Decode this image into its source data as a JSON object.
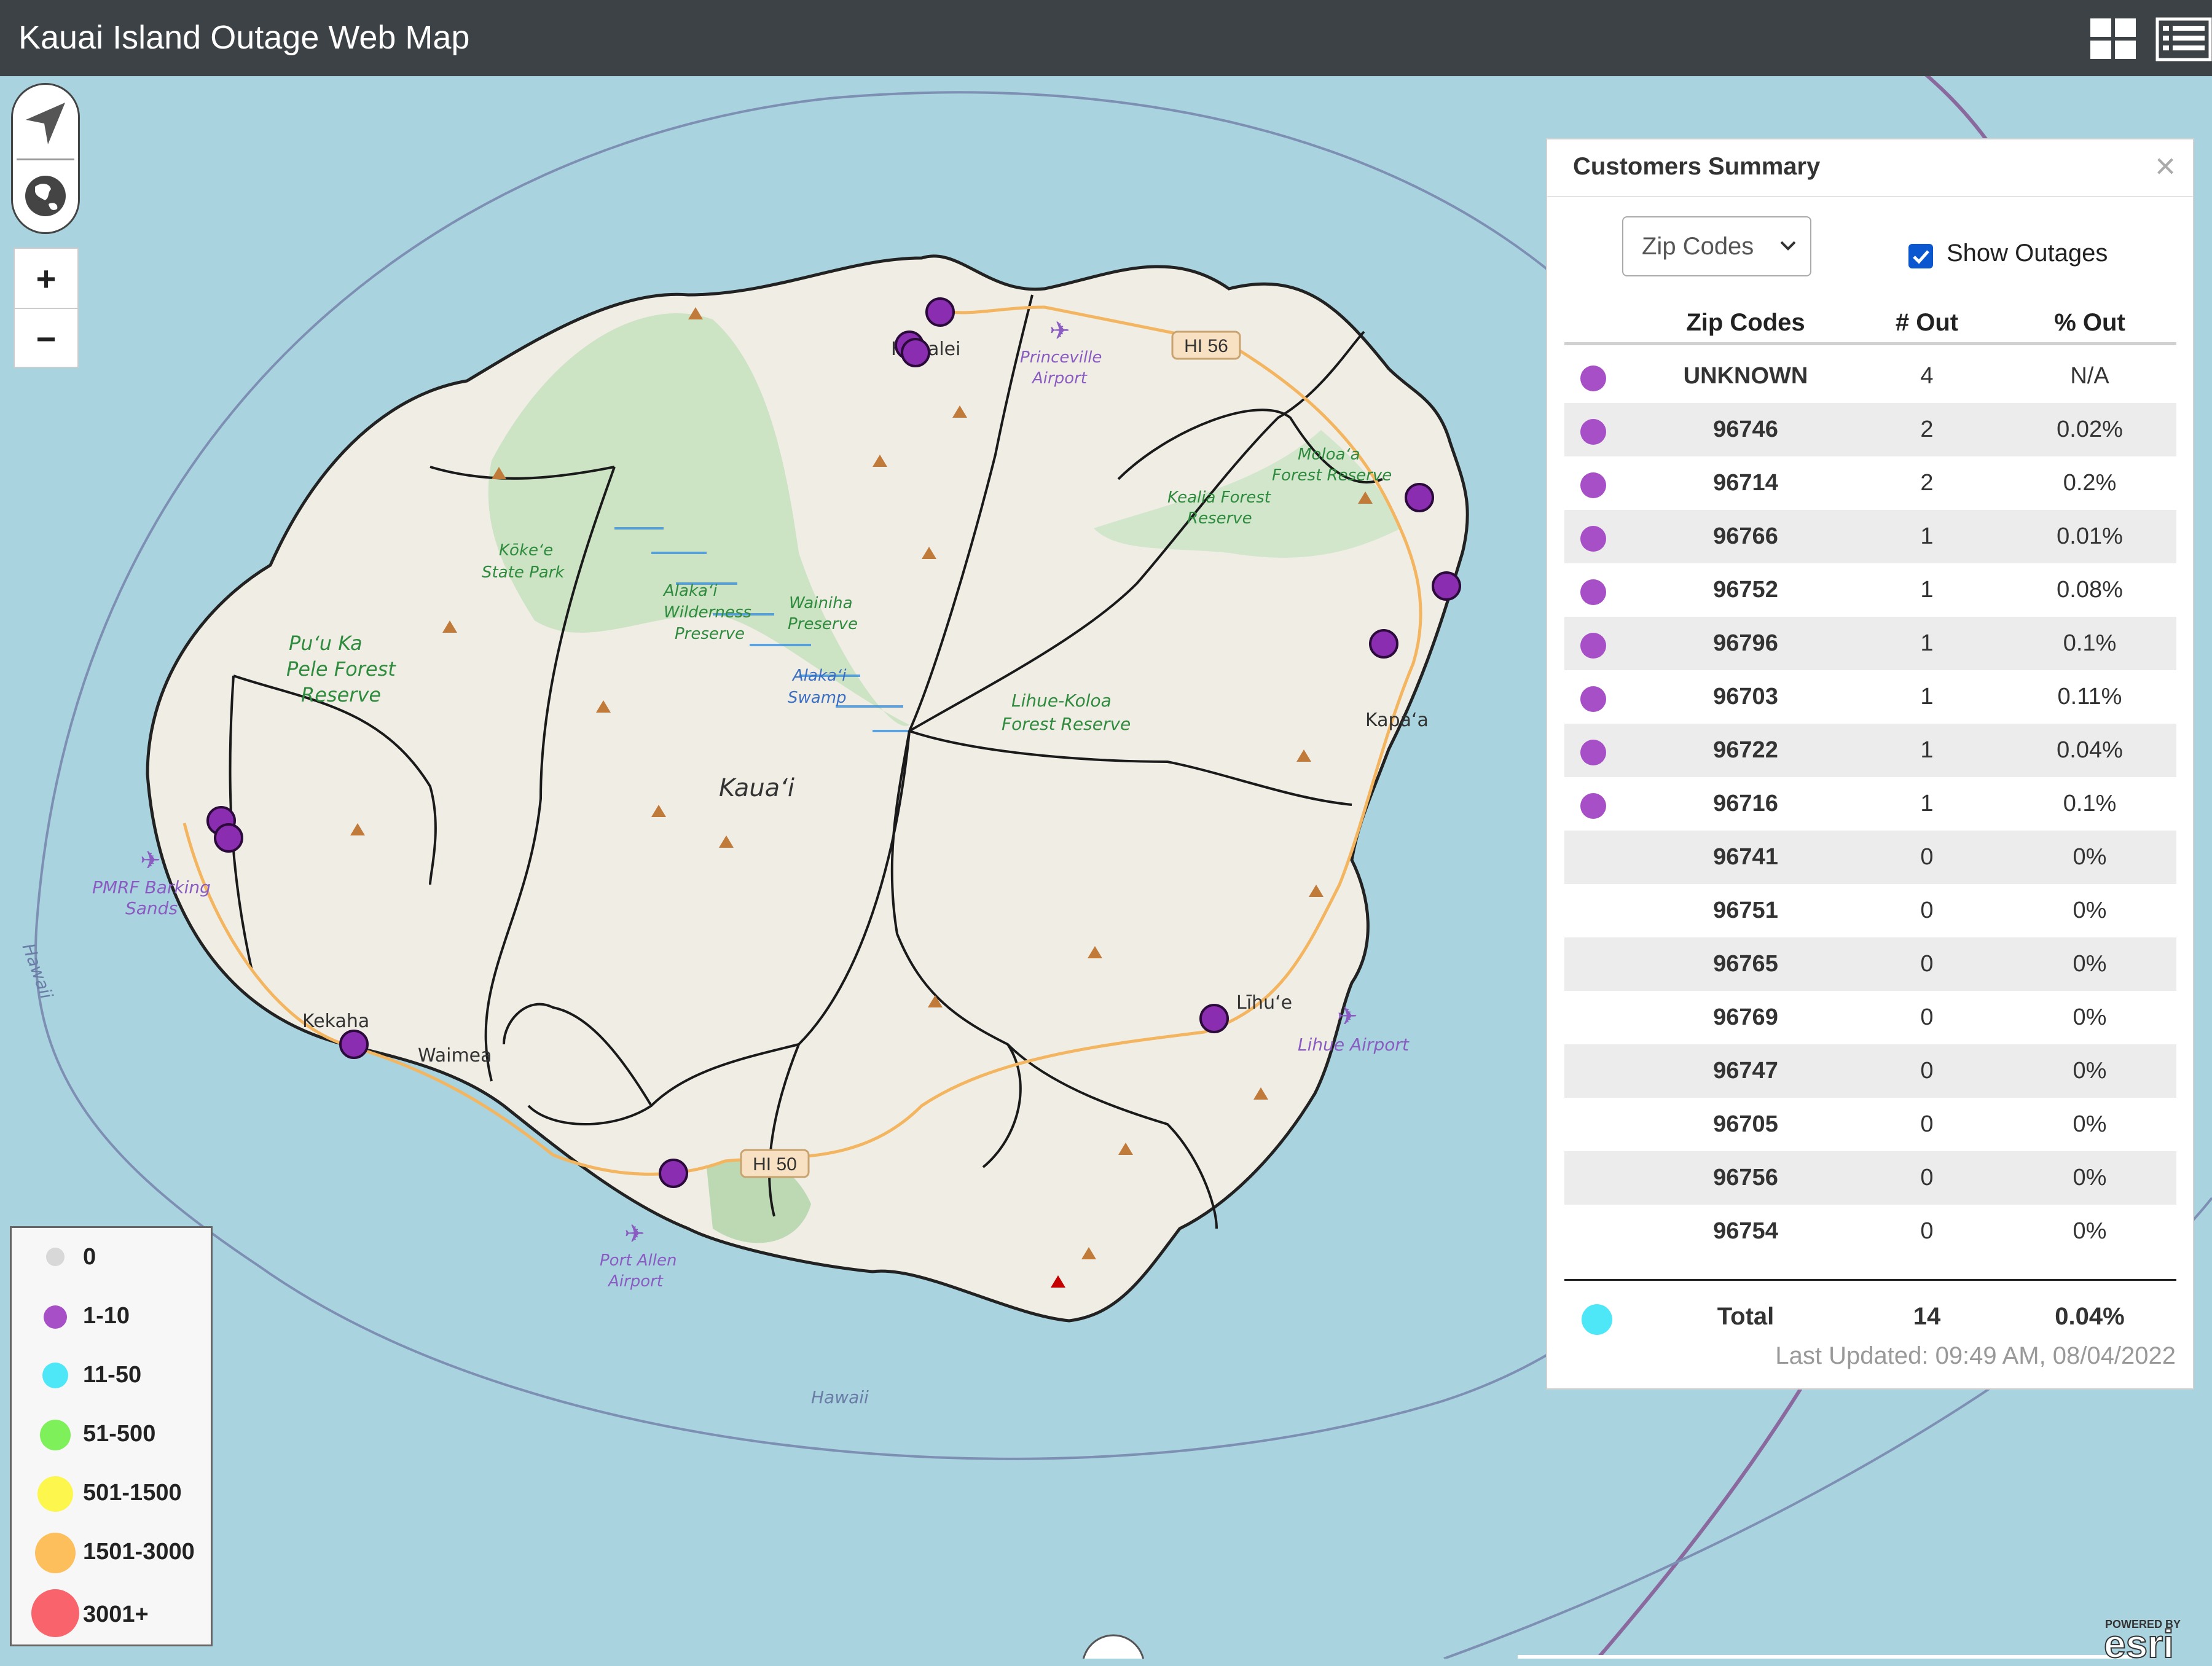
{
  "app": {
    "title": "Kauai Island Outage Web Map"
  },
  "header": {
    "grid_icon": "grid-icon",
    "list_icon": "list-icon"
  },
  "map_controls": {
    "locate_icon": "navigation-arrow-icon",
    "basemap_icon": "globe-icon",
    "zoom_in": "+",
    "zoom_out": "−"
  },
  "map_labels": {
    "island": "Kauaʻi",
    "sea_labels": [
      "Hawaii",
      "Hawaii"
    ],
    "places": [
      "Hanalei",
      "Princeville Airport",
      "Kapaʻa",
      "Līhuʻe",
      "Lihue Airport",
      "Kekaha",
      "Waimea",
      "Port Allen Airport",
      "PMRF Barking Sands"
    ],
    "parks": [
      "Puʻu Ka Pele Forest Reserve",
      "Kōkeʻe State Park",
      "Alakaʻi Wilderness Preserve",
      "Wainiha Preserve",
      "Alakaʻi Swamp",
      "Lihue-Koloa Forest Reserve",
      "Moloaʻa Forest Reserve",
      "Kealia Forest Reserve"
    ],
    "roads": [
      "HI 56",
      "HI 50"
    ]
  },
  "legend": {
    "items": [
      {
        "label": "0",
        "color": "#d8d8d8"
      },
      {
        "label": "1-10",
        "color": "#a64fc6"
      },
      {
        "label": "11-50",
        "color": "#4ee7f8"
      },
      {
        "label": "51-500",
        "color": "#7ef05a"
      },
      {
        "label": "501-1500",
        "color": "#fdf64d"
      },
      {
        "label": "1501-3000",
        "color": "#fdbf5c"
      },
      {
        "label": "3001+",
        "color": "#f9636b"
      }
    ]
  },
  "panel": {
    "title": "Customers Summary",
    "close": "×",
    "select_value": "Zip Codes",
    "show_outages_label": "Show Outages",
    "show_outages_checked": true,
    "columns": [
      "Zip Codes",
      "# Out",
      "% Out"
    ],
    "rows": [
      {
        "zip": "UNKNOWN",
        "out": "4",
        "pct": "N/A",
        "marker": true
      },
      {
        "zip": "96746",
        "out": "2",
        "pct": "0.02%",
        "marker": true
      },
      {
        "zip": "96714",
        "out": "2",
        "pct": "0.2%",
        "marker": true
      },
      {
        "zip": "96766",
        "out": "1",
        "pct": "0.01%",
        "marker": true
      },
      {
        "zip": "96752",
        "out": "1",
        "pct": "0.08%",
        "marker": true
      },
      {
        "zip": "96796",
        "out": "1",
        "pct": "0.1%",
        "marker": true
      },
      {
        "zip": "96703",
        "out": "1",
        "pct": "0.11%",
        "marker": true
      },
      {
        "zip": "96722",
        "out": "1",
        "pct": "0.04%",
        "marker": true
      },
      {
        "zip": "96716",
        "out": "1",
        "pct": "0.1%",
        "marker": true
      },
      {
        "zip": "96741",
        "out": "0",
        "pct": "0%",
        "marker": false
      },
      {
        "zip": "96751",
        "out": "0",
        "pct": "0%",
        "marker": false
      },
      {
        "zip": "96765",
        "out": "0",
        "pct": "0%",
        "marker": false
      },
      {
        "zip": "96769",
        "out": "0",
        "pct": "0%",
        "marker": false
      },
      {
        "zip": "96747",
        "out": "0",
        "pct": "0%",
        "marker": false
      },
      {
        "zip": "96705",
        "out": "0",
        "pct": "0%",
        "marker": false
      },
      {
        "zip": "96756",
        "out": "0",
        "pct": "0%",
        "marker": false
      },
      {
        "zip": "96754",
        "out": "0",
        "pct": "0%",
        "marker": false
      }
    ],
    "total": {
      "label": "Total",
      "out": "14",
      "pct": "0.04%"
    },
    "last_updated": "Last Updated: 09:49 AM, 08/04/2022"
  },
  "attribution": {
    "powered_by": "POWERED BY",
    "brand": "esri"
  }
}
